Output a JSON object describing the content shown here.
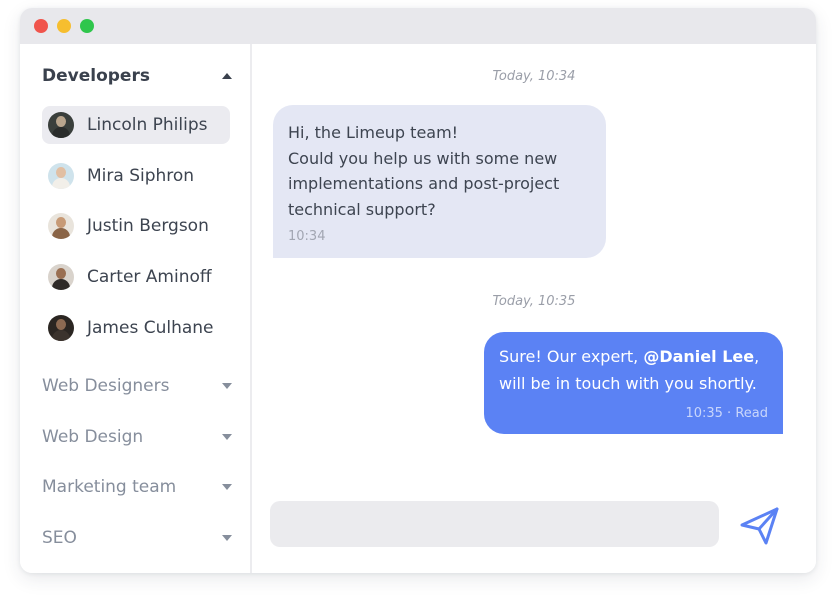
{
  "window": {
    "traffic_lights": [
      "close",
      "minimize",
      "maximize"
    ]
  },
  "sidebar": {
    "groups": [
      {
        "label": "Developers",
        "expanded": true,
        "members": [
          {
            "name": "Lincoln Philips",
            "active": true
          },
          {
            "name": "Mira Siphron",
            "active": false
          },
          {
            "name": "Justin Bergson",
            "active": false
          },
          {
            "name": "Carter Aminoff",
            "active": false
          },
          {
            "name": "James Culhane",
            "active": false
          }
        ]
      },
      {
        "label": "Web Designers",
        "expanded": false
      },
      {
        "label": "Web Design",
        "expanded": false
      },
      {
        "label": "Marketing team",
        "expanded": false
      },
      {
        "label": "SEO",
        "expanded": false
      }
    ]
  },
  "chat": {
    "messages": [
      {
        "date_label": "Today, 10:34",
        "direction": "incoming",
        "lines": [
          "Hi, the Limeup team!",
          "Could you help us with some new",
          "implementations and post-project",
          "technical support?"
        ],
        "time": "10:34"
      },
      {
        "date_label": "Today, 10:35",
        "direction": "outgoing",
        "text_before": "Sure! Our expert, ",
        "mention": "@Daniel Lee",
        "text_after": ",",
        "line2": "will be in touch with you shortly.",
        "time": "10:35",
        "separator": " · ",
        "status": "Read"
      }
    ],
    "composer": {
      "value": "",
      "placeholder": ""
    },
    "send_icon": "paper-plane-icon"
  },
  "colors": {
    "accent": "#5b82f4",
    "incoming_bubble": "#e4e7f4",
    "titlebar": "#e8e8ec",
    "close": "#f0544c",
    "minimize": "#f6be2f",
    "maximize": "#2fc64c"
  }
}
